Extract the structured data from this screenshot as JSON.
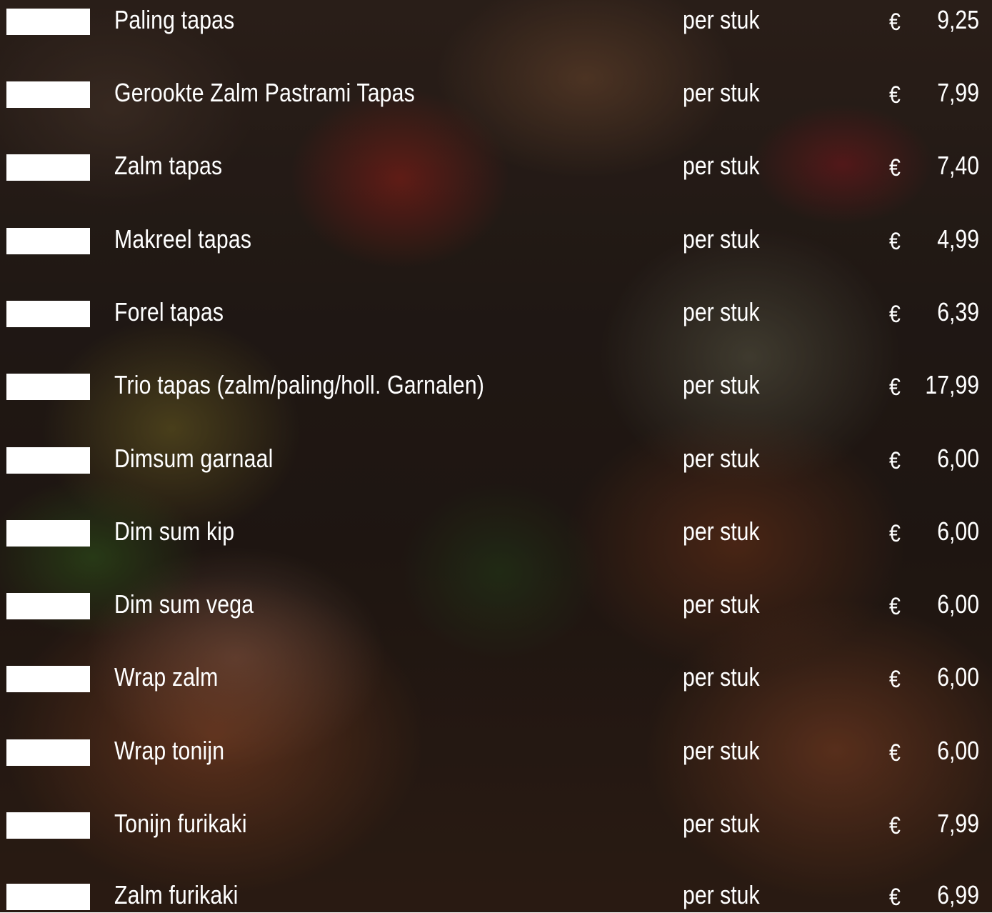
{
  "menu": {
    "items": [
      {
        "name": "Paling tapas",
        "unit": "per stuk",
        "currency": "€",
        "price": "9,25"
      },
      {
        "name": "Gerookte Zalm Pastrami Tapas",
        "unit": "per stuk",
        "currency": "€",
        "price": "7,99"
      },
      {
        "name": "Zalm tapas",
        "unit": "per stuk",
        "currency": "€",
        "price": "7,40"
      },
      {
        "name": "Makreel tapas",
        "unit": "per stuk",
        "currency": "€",
        "price": "4,99"
      },
      {
        "name": "Forel tapas",
        "unit": "per stuk",
        "currency": "€",
        "price": "6,39"
      },
      {
        "name": "Trio tapas (zalm/paling/holl. Garnalen)",
        "unit": "per stuk",
        "currency": "€",
        "price": "17,99"
      },
      {
        "name": "Dimsum garnaal",
        "unit": "per stuk",
        "currency": "€",
        "price": "6,00"
      },
      {
        "name": "Dim sum kip",
        "unit": "per stuk",
        "currency": "€",
        "price": "6,00"
      },
      {
        "name": "Dim sum vega",
        "unit": "per stuk",
        "currency": "€",
        "price": "6,00"
      },
      {
        "name": "Wrap zalm",
        "unit": "per stuk",
        "currency": "€",
        "price": "6,00"
      },
      {
        "name": "Wrap tonijn",
        "unit": "per stuk",
        "currency": "€",
        "price": "6,00"
      },
      {
        "name": "Tonijn furikaki",
        "unit": "per stuk",
        "currency": "€",
        "price": "7,99"
      },
      {
        "name": "Zalm furikaki",
        "unit": "per stuk",
        "currency": "€",
        "price": "6,99"
      }
    ]
  },
  "colors": {
    "text": "#ffffff",
    "quantity_box": "#ffffff"
  }
}
